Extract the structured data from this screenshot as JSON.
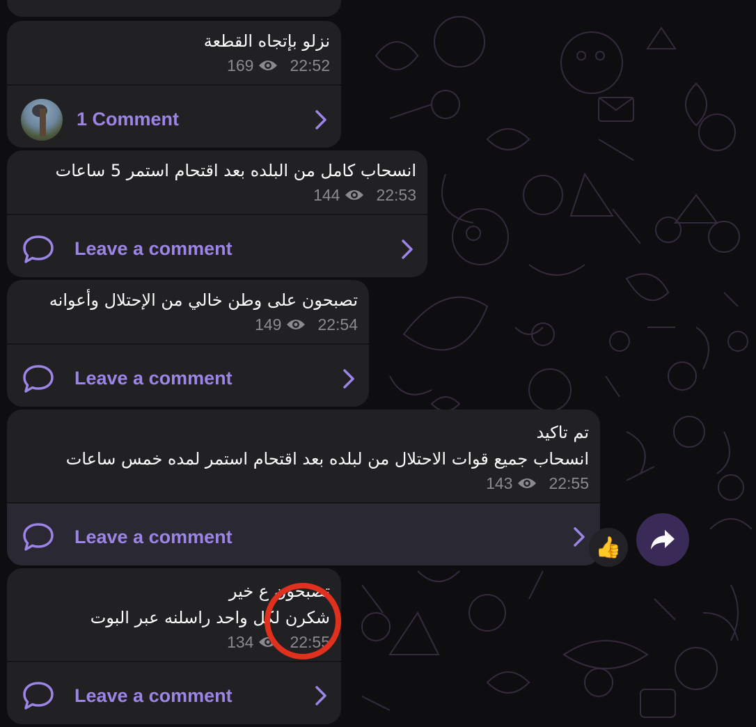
{
  "colors": {
    "bubble_bg": "#212023",
    "accent": "#9c85e6",
    "meta": "#8b8a90",
    "highlight_row": "#2a2832",
    "share_bg": "#3a2a58",
    "annotation": "#e0301e"
  },
  "messages": [
    {
      "lines": [
        "نزلو بإتجاه القطعة"
      ],
      "views": "169",
      "time": "22:52",
      "comment_label": "1 Comment"
    },
    {
      "lines": [
        "انسحاب كامل من البلده بعد اقتحام استمر 5 ساعات"
      ],
      "views": "144",
      "time": "22:53",
      "comment_label": "Leave a comment"
    },
    {
      "lines": [
        "تصبحون على وطن خالي من الإحتلال وأعوانه"
      ],
      "views": "149",
      "time": "22:54",
      "comment_label": "Leave a comment"
    },
    {
      "lines": [
        "تم تاكيد",
        "انسحاب جميع قوات الاحتلال  من لبلده بعد اقتحام استمر لمده خمس ساعات"
      ],
      "views": "143",
      "time": "22:55",
      "comment_label": "Leave a comment"
    },
    {
      "lines": [
        "تصبحون ع خير",
        "شكرن لكل واحد راسلنه عبر البوت"
      ],
      "views": "134",
      "time": "22:55",
      "comment_label": "Leave a comment"
    }
  ],
  "reaction_emoji": "👍",
  "icons": {
    "views": "eye-icon",
    "comment": "comment-bubble-icon",
    "chevron": "chevron-right-icon",
    "share": "share-arrow-icon"
  }
}
